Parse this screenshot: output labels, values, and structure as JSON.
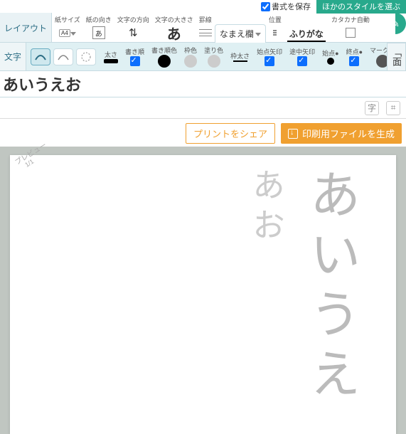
{
  "top": {
    "save_style_label": "書式を保存",
    "choose_style_label": "ほかのスタイルを選ぶ"
  },
  "side_panel_label": "「面",
  "row1": {
    "layout_tab": "レイアウト",
    "paper_size_lbl": "紙サイズ",
    "paper_size_val": "A4",
    "paper_orient_lbl": "紙の向き",
    "paper_orient_val": "あ",
    "text_dir_lbl": "文字の方向",
    "text_dir_val": "⇅",
    "text_size_lbl": "文字の大きさ",
    "text_size_val": "あ",
    "keisen_lbl": "罫線",
    "name_tab": "なまえ欄",
    "pos_lbl": "位置",
    "furigana_tab": "ふりがな",
    "katakana_lbl": "カタカナ自動"
  },
  "row2": {
    "moji_tab": "文字",
    "thickness_lbl": "太さ",
    "stroke_order_lbl": "書き順",
    "stroke_color_lbl": "書き順色",
    "frame_color_lbl": "枠色",
    "fill_color_lbl": "塗り色",
    "frame_thick_lbl": "枠太さ",
    "start_arrow_lbl": "始点矢印",
    "mid_arrow_lbl": "途中矢印",
    "start_dot_lbl": "始点●",
    "end_dot_lbl": "終点●",
    "mark_color_lbl": "マーク色"
  },
  "input_text": "あいうえお",
  "under_tools": {
    "char": "字",
    "grid": "⌗"
  },
  "actions": {
    "share_label": "プリントをシェア",
    "generate_label": "印刷用ファイルを生成"
  },
  "preview": {
    "label": "プレビュー",
    "page": "1/1",
    "col_big_chars": "あいうえ",
    "col_small_chars": "あお"
  }
}
